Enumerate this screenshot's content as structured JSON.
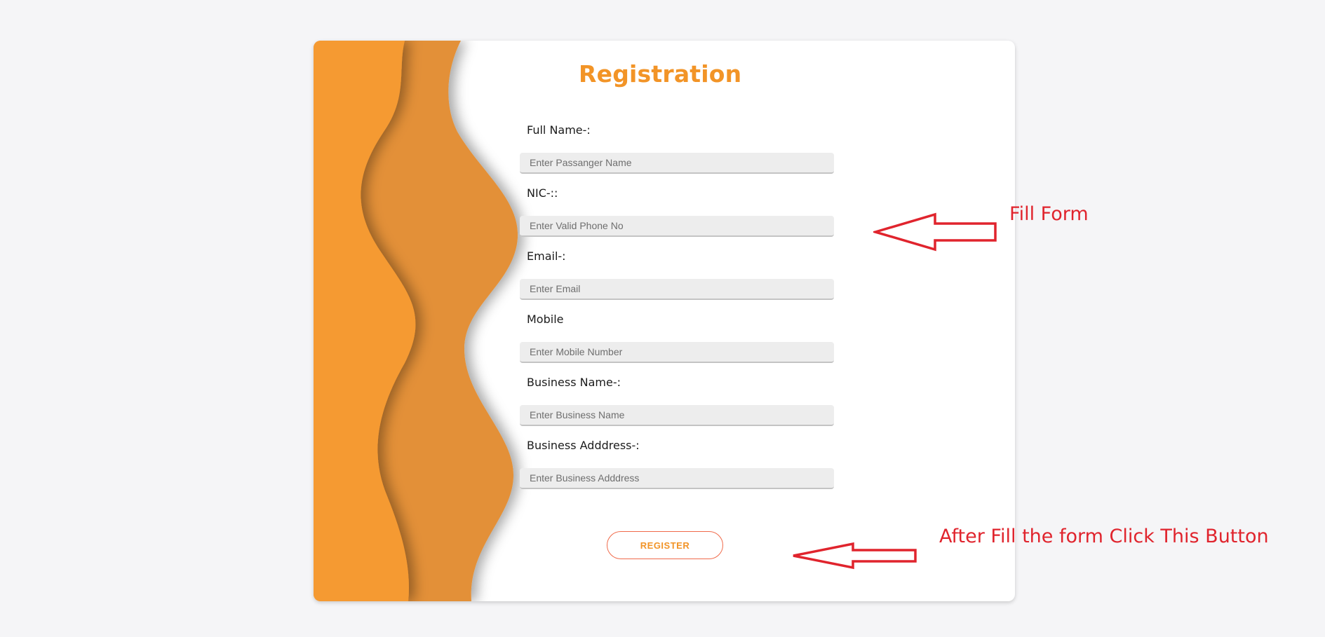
{
  "form": {
    "title": "Registration",
    "fields": [
      {
        "label": "Full Name-:",
        "placeholder": "Enter Passanger Name"
      },
      {
        "label": "NIC-::",
        "placeholder": "Enter Valid Phone No"
      },
      {
        "label": "Email-:",
        "placeholder": "Enter Email"
      },
      {
        "label": "Mobile",
        "placeholder": "Enter Mobile Number"
      },
      {
        "label": "Business Name-:",
        "placeholder": "Enter Business Name"
      },
      {
        "label": "Business Adddress-:",
        "placeholder": "Enter Business Adddress"
      }
    ],
    "submit_label": "REGISTER"
  },
  "annotations": {
    "fill_form": "Fill Form",
    "click_button": "After Fill the form Click This Button",
    "color": "#e0242d"
  },
  "colors": {
    "accent": "#f29427",
    "wave_light": "#f59a33",
    "wave_dark": "#e39038",
    "button_border": "#f06a4a"
  }
}
